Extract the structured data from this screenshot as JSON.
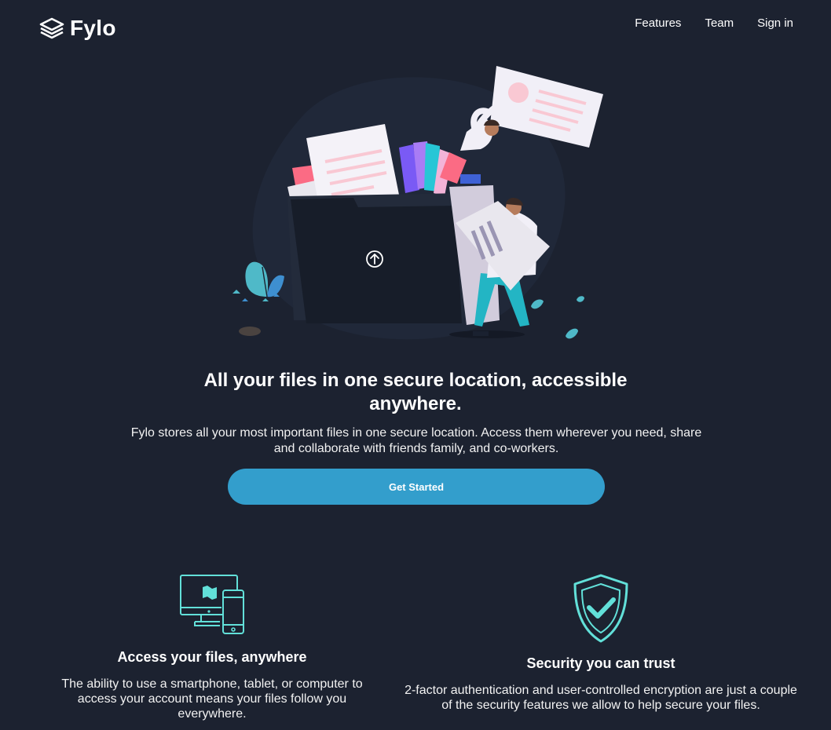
{
  "brand": {
    "name": "Fylo",
    "logo_icon": "stacked-layers-icon"
  },
  "nav": {
    "items": [
      {
        "label": "Features"
      },
      {
        "label": "Team"
      },
      {
        "label": "Sign in"
      }
    ]
  },
  "hero": {
    "title": "All your files in one secure location, accessible anywhere.",
    "description": "Fylo stores all your most important files in one secure location. Access them wherever you need, share and collaborate with friends family, and co-workers.",
    "cta_label": "Get Started",
    "illustration_icon": "upload-arrow-icon"
  },
  "features": [
    {
      "icon": "devices-icon",
      "title": "Access your files, anywhere",
      "description": "The ability to use a smartphone, tablet, or computer to access your account means your files follow you everywhere."
    },
    {
      "icon": "shield-check-icon",
      "title": "Security you can trust",
      "description": "2-factor authentication and user-controlled encryption are just a couple of the security features we allow to help secure your files."
    }
  ],
  "colors": {
    "background": "#1c2230",
    "accent": "#339ecc",
    "icon_cyan": "#62e0d9",
    "text": "#ffffff"
  }
}
